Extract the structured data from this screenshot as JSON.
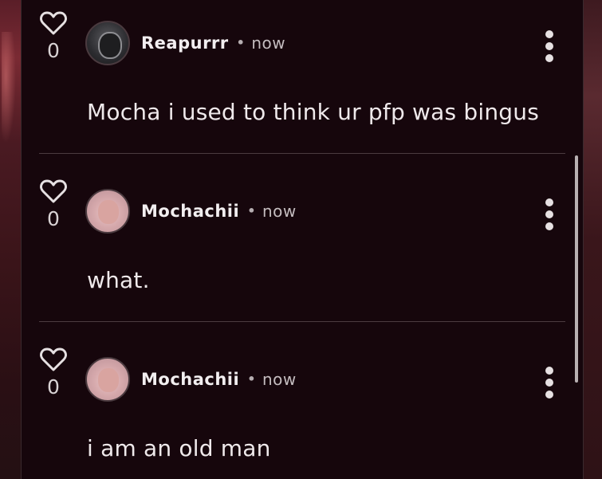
{
  "comments": [
    {
      "likes": "0",
      "username": "Reapurrr",
      "separator": "•",
      "time": "now",
      "text": "Mocha i used to think ur pfp was bingus",
      "avatar": "reaper-avatar"
    },
    {
      "likes": "0",
      "username": "Mochachii",
      "separator": "•",
      "time": "now",
      "text": "what.",
      "avatar": "mochachii-avatar"
    },
    {
      "likes": "0",
      "username": "Mochachii",
      "separator": "•",
      "time": "now",
      "text": "i am an old man",
      "avatar": "mochachii-avatar"
    }
  ],
  "icons": {
    "like": "heart-outline-icon",
    "menu": "more-vertical-icon"
  },
  "colors": {
    "background": "#16060c",
    "text": "#efe9eb",
    "muted": "#c4bcbf"
  }
}
